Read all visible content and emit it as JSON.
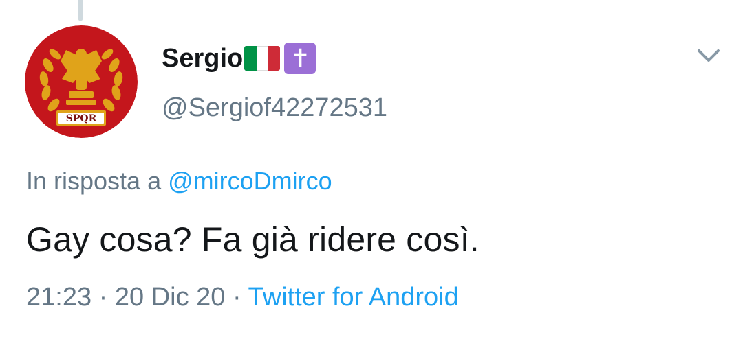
{
  "tweet": {
    "author": {
      "display_name": "Sergio",
      "handle": "@Sergiof42272531",
      "avatar_icon": "spqr-eagle-emblem",
      "avatar_text": "SPQR",
      "flag_emoji": "italy-flag",
      "cross_emoji": "✝",
      "flag_colors": [
        "#009246",
        "#ffffff",
        "#ce2b37"
      ]
    },
    "reply": {
      "prefix": "In risposta a",
      "target": "@mircoDmirco"
    },
    "text": "Gay cosa? Fa già ridere così.",
    "time": "21:23",
    "separator": "·",
    "date": "20 Dic 20",
    "source": "Twitter for Android"
  },
  "colors": {
    "text_primary": "#14171a",
    "text_secondary": "#657786",
    "link": "#1da1f2",
    "avatar_bg": "#c4161c",
    "emblem_gold": "#e0a31a"
  }
}
